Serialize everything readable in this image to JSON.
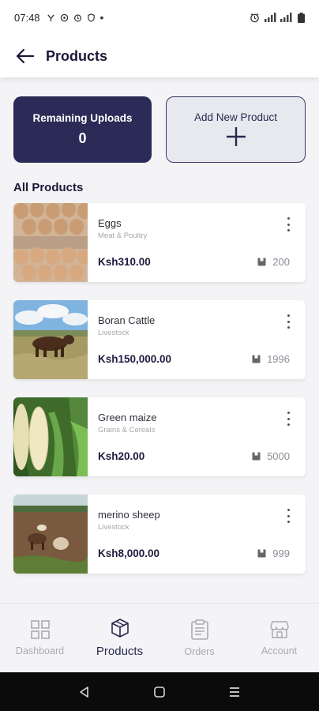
{
  "status_bar": {
    "time": "07:48"
  },
  "header": {
    "title": "Products"
  },
  "summary": {
    "remaining_label": "Remaining Uploads",
    "remaining_value": "0",
    "add_label": "Add New Product"
  },
  "section_title": "All Products",
  "products": [
    {
      "name": "Eggs",
      "category": "Meat & Poultry",
      "price": "Ksh310.00",
      "stock": "200"
    },
    {
      "name": "Boran Cattle",
      "category": "Livestock",
      "price": "Ksh150,000.00",
      "stock": "1996"
    },
    {
      "name": "Green maize",
      "category": "Grains & Cereals",
      "price": "Ksh20.00",
      "stock": "5000"
    },
    {
      "name": "merino sheep",
      "category": "Livestock",
      "price": "Ksh8,000.00",
      "stock": "999"
    }
  ],
  "bottom_nav": [
    {
      "label": "Dashboard",
      "icon": "dashboard-icon"
    },
    {
      "label": "Products",
      "icon": "box-icon",
      "active": true
    },
    {
      "label": "Orders",
      "icon": "clipboard-icon"
    },
    {
      "label": "Account",
      "icon": "store-icon"
    }
  ],
  "colors": {
    "primary": "#2c2a56",
    "background": "#f4f4f6",
    "muted": "#a6a6ad"
  }
}
